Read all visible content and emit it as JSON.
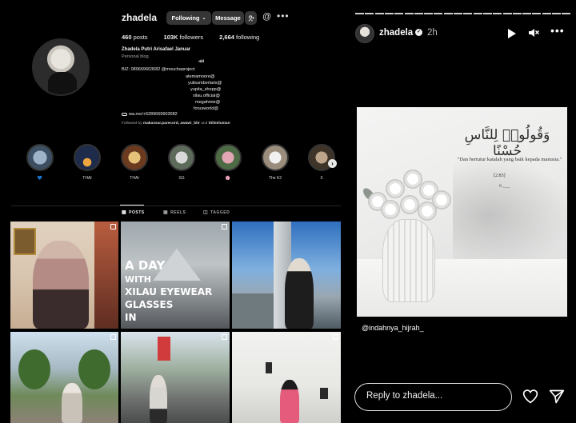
{
  "profile": {
    "username": "zhadela",
    "following_btn": "Following",
    "following_chevron": "⌄",
    "message_btn": "Message",
    "threads_icon": "threads-icon",
    "stats": {
      "posts": "460",
      "posts_label": "posts",
      "followers": "103K",
      "followers_label": "followers",
      "following": "2,664",
      "following_label": "following"
    },
    "full_name": "Zhadela Putri Arisafael Januar",
    "category": "Personal blog",
    "bio_symbol": "ﷲ",
    "bio_biz": "BIZ: 089669603082 @moucheproject",
    "bio_lines": [
      "atemamoore@",
      "yulisumberlaris@",
      "yupita_shopp@",
      "xilau.official@",
      "megahmie@",
      "forusworld@"
    ],
    "link": "wa.me/+6289669603082",
    "followed_by_prefix": "Followed by",
    "followed_by_names": "makassar.parecord, awawi_bhr",
    "followed_by_and": "and",
    "followed_by_last": "titilmiluman",
    "highlights": [
      {
        "label": "💙"
      },
      {
        "label": "THAI"
      },
      {
        "label": "THAI"
      },
      {
        "label": "SG"
      },
      {
        "label": "🌸"
      },
      {
        "label": "The K2"
      },
      {
        "label": "X"
      }
    ],
    "tabs": {
      "posts": "POSTS",
      "reels": "REELS",
      "tagged": "TAGGED"
    },
    "post2_text": {
      "line1": "A DAY",
      "line2": "WITH",
      "line3": "XILAU EYEWEAR",
      "line4": "GLASSES",
      "line5": "IN"
    }
  },
  "story": {
    "username": "zhadela",
    "verified_mark": "✓",
    "time": "2h",
    "mute_icon": "mute-icon",
    "more_icon": "more-icon",
    "segments": 22,
    "arabic": "وَقُولُوا۟ لِلنَّاسِ حُسْنًا",
    "quote": "\"Dan bertutur katalah yang baik kepada manusia.\"",
    "ref": "[2:83]",
    "sig": "6.___",
    "mention": "@indahnya_hijrah_",
    "reply_placeholder": "Reply to zhadela..."
  },
  "colors": {
    "background": "#000000",
    "button": "#363636",
    "text": "#f5f5f5",
    "muted": "#a8a8a8"
  }
}
